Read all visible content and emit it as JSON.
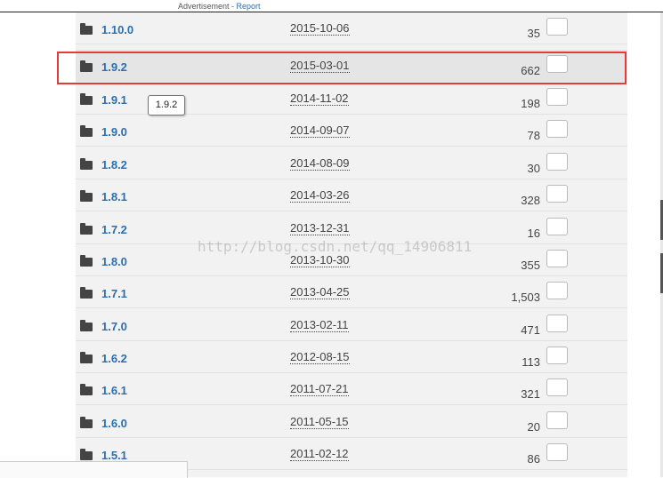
{
  "ad": {
    "label": "Advertisement",
    "separator": " - ",
    "report": "Report"
  },
  "tooltip": "1.9.2",
  "watermark": "http://blog.csdn.net/qq_14906811",
  "rows": [
    {
      "name": "1.10.0",
      "date": "2015-10-06",
      "count": "35"
    },
    {
      "name": "1.9.2",
      "date": "2015-03-01",
      "count": "662"
    },
    {
      "name": "1.9.1",
      "date": "2014-11-02",
      "count": "198"
    },
    {
      "name": "1.9.0",
      "date": "2014-09-07",
      "count": "78"
    },
    {
      "name": "1.8.2",
      "date": "2014-08-09",
      "count": "30"
    },
    {
      "name": "1.8.1",
      "date": "2014-03-26",
      "count": "328"
    },
    {
      "name": "1.7.2",
      "date": "2013-12-31",
      "count": "16"
    },
    {
      "name": "1.8.0",
      "date": "2013-10-30",
      "count": "355"
    },
    {
      "name": "1.7.1",
      "date": "2013-04-25",
      "count": "1,503"
    },
    {
      "name": "1.7.0",
      "date": "2013-02-11",
      "count": "471"
    },
    {
      "name": "1.6.2",
      "date": "2012-08-15",
      "count": "113"
    },
    {
      "name": "1.6.1",
      "date": "2011-07-21",
      "count": "321"
    },
    {
      "name": "1.6.0",
      "date": "2011-05-15",
      "count": "20"
    },
    {
      "name": "1.5.1",
      "date": "2011-02-12",
      "count": "86"
    }
  ],
  "colors": {
    "link": "#2a6fb0",
    "highlight_border": "#e53a3a",
    "row_bg": "#f2f2f2"
  }
}
